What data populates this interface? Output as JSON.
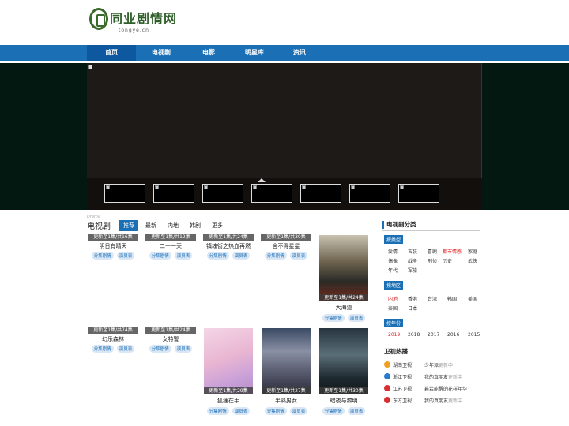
{
  "brand": {
    "name": "同业剧情网",
    "domain": "tongye.cn",
    "color": "#2f5e2a"
  },
  "nav": {
    "items": [
      "首页",
      "电视剧",
      "电影",
      "明星库",
      "资讯"
    ],
    "active": 0,
    "color": "#1a6fb5"
  },
  "section": {
    "small": "Drama",
    "title": "电视剧",
    "tabs": [
      "推荐",
      "最新",
      "内地",
      "韩剧",
      "更多"
    ],
    "active_tab": 0
  },
  "cards_row1": [
    {
      "status": "更新至1集/共16集",
      "name": "明日有晴天"
    },
    {
      "status": "更新至1集/共12集",
      "name": "二十一天"
    },
    {
      "status": "更新至1集/共24集",
      "name": "镇魂街之热血再燃"
    },
    {
      "status": "更新至1集/共30集",
      "name": "舍不得星星"
    }
  ],
  "cards_row2": [
    {
      "status": "更新至1集/共74集",
      "name": "幻乐森林"
    },
    {
      "status": "更新至1集/共24集",
      "name": "女特警"
    }
  ],
  "posters": [
    {
      "status": "更新至1集/共24集",
      "name": "大海道"
    },
    {
      "status": "更新至1集/共29集",
      "name": "狐狸在手"
    },
    {
      "status": "更新至1集/共27集",
      "name": "半熟男女"
    },
    {
      "status": "更新至1集/共30集",
      "name": "暗夜与黎明"
    }
  ],
  "btn_labels": {
    "a": "分集剧情",
    "b": "演员表"
  },
  "sidebar": {
    "title": "电视剧分类",
    "by_type_label": "按类型",
    "types": [
      "爱情",
      "古装",
      "喜剧",
      "都市情感",
      "家庭",
      "偶像",
      "战争",
      "刑侦",
      "历史",
      "武侠",
      "年代",
      "军旅"
    ],
    "types_hot": 3,
    "by_region_label": "按地区",
    "regions": [
      "内地",
      "香港",
      "台湾",
      "韩国",
      "美国",
      "泰国",
      "日本"
    ],
    "regions_hot": 0,
    "by_year_label": "按年份",
    "years": [
      "2019",
      "2018",
      "2017",
      "2016",
      "2015"
    ],
    "years_hot": 0,
    "hot_title": "卫视热播",
    "channels": [
      {
        "name": "湖南卫视",
        "show": "少年派",
        "tag": "更新中",
        "color": "#f0a020",
        "icon": "hunan-tv-logo-icon"
      },
      {
        "name": "浙江卫视",
        "show": "我的真朋友",
        "tag": "更新中",
        "color": "#2a7ad0",
        "icon": "zhejiang-tv-logo-icon"
      },
      {
        "name": "江苏卫视",
        "show": "暮若能醒的花样年华",
        "tag": "",
        "color": "#d83030",
        "icon": "jiangsu-tv-logo-icon"
      },
      {
        "name": "东方卫视",
        "show": "我的真朋友",
        "tag": "更新中",
        "color": "#d83030",
        "icon": "dragon-tv-logo-icon"
      }
    ]
  }
}
